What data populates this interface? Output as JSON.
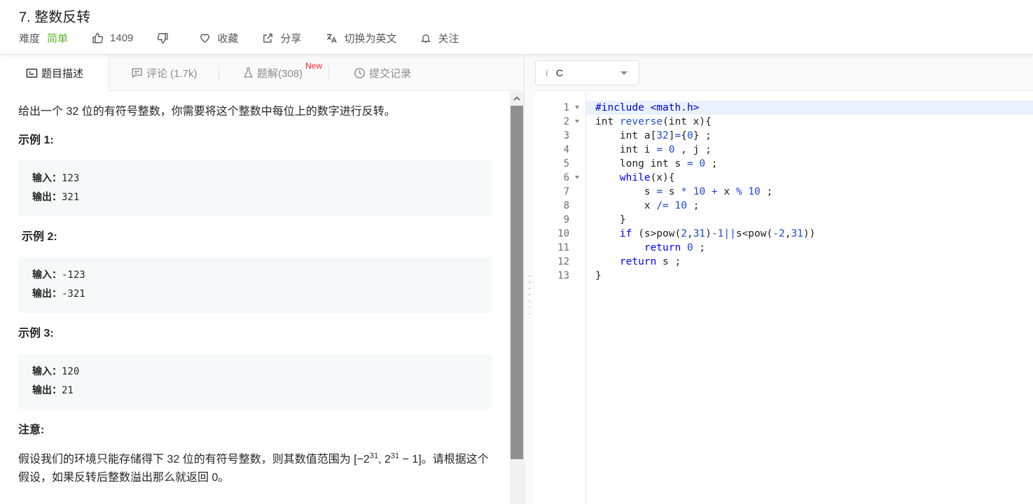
{
  "problem": {
    "title": "7. 整数反转",
    "difficulty_label": "难度",
    "difficulty": "简单",
    "likes": "1409",
    "favorite_label": "收藏",
    "share_label": "分享",
    "switch_lang_label": "切换为英文",
    "follow_label": "关注"
  },
  "tabs": [
    {
      "label": "题目描述"
    },
    {
      "label": "评论 (1.7k)"
    },
    {
      "label": "题解(308)",
      "badge": "New"
    },
    {
      "label": "提交记录"
    }
  ],
  "description": {
    "intro": "给出一个 32 位的有符号整数，你需要将这个整数中每位上的数字进行反转。",
    "examples": [
      {
        "title": "示例 1:",
        "input_label": "输入：",
        "input": "123",
        "output_label": "输出：",
        "output": "321"
      },
      {
        "title": "示例 2:",
        "input_label": "输入：",
        "input": "-123",
        "output_label": "输出：",
        "output": "-321"
      },
      {
        "title": "示例 3:",
        "input_label": "输入：",
        "input": "120",
        "output_label": "输出：",
        "output": "21"
      }
    ],
    "note_title": "注意:",
    "note_before": "假设我们的环境只能存储得下 32 位的有符号整数，则其数值范围为 [−2",
    "note_exp1": "31",
    "note_mid": ",  2",
    "note_exp2": "31",
    "note_after": " − 1]。请根据这个假设，如果反转后整数溢出那么就返回 0。"
  },
  "editor": {
    "language": "C",
    "language_info": "i",
    "line_numbers": [
      "1",
      "2",
      "3",
      "4",
      "5",
      "6",
      "7",
      "8",
      "9",
      "10",
      "11",
      "12",
      "13"
    ]
  },
  "code_lines": [
    "#include <math.h>",
    "int reverse(int x){",
    "    int a[32]={0} ;",
    "    int i = 0 , j ;",
    "    long int s = 0 ;",
    "    while(x){",
    "        s = s * 10 + x % 10 ;",
    "        x /= 10 ;",
    "    }",
    "    if (s>pow(2,31)-1||s<pow(-2,31))",
    "        return 0 ;",
    "    return s ;",
    "}"
  ],
  "colors": {
    "difficulty_easy": "#5ab726",
    "new_badge": "#f5222d",
    "keyword": "#0000ff",
    "number": "#1e4bd2",
    "active_line": "#e8f2ff"
  }
}
